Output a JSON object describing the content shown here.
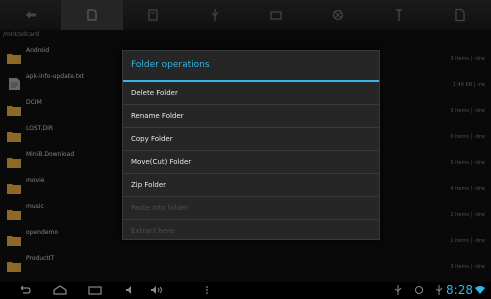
{
  "tabs": [
    {
      "id": "back",
      "icon": "back-arrow-icon",
      "active": false
    },
    {
      "id": "sdcard",
      "icon": "sdcard-icon",
      "active": true
    },
    {
      "id": "internal",
      "icon": "storage-icon",
      "active": false
    },
    {
      "id": "usb",
      "icon": "usb-icon",
      "active": false
    },
    {
      "id": "media",
      "icon": "card-icon",
      "active": false
    },
    {
      "id": "settings",
      "icon": "gear-icon",
      "active": false
    },
    {
      "id": "tools",
      "icon": "hammer-icon",
      "active": false
    },
    {
      "id": "file",
      "icon": "file-icon",
      "active": false
    }
  ],
  "path": "/mnt/sdcard",
  "files": [
    {
      "name": "Android",
      "info": "3 items | -drw",
      "type": "folder"
    },
    {
      "name": "apk-info-update.txt",
      "info": "1.46 KB | -rw",
      "type": "file"
    },
    {
      "name": "DCIM",
      "info": "3 items | -drw",
      "type": "folder"
    },
    {
      "name": "LOST.DIR",
      "info": "0 items | -drw",
      "type": "folder"
    },
    {
      "name": "MiniB.Download",
      "info": "5 items | -drw",
      "type": "folder"
    },
    {
      "name": "movie",
      "info": "4 items | -drw",
      "type": "folder"
    },
    {
      "name": "music",
      "info": "2 items | -drw",
      "type": "folder"
    },
    {
      "name": "opendemo",
      "info": "1 items | -drw",
      "type": "folder"
    },
    {
      "name": "ProductIT",
      "info": "3 items | -drw",
      "type": "folder"
    }
  ],
  "dialog": {
    "title": "Folder operations",
    "options": [
      {
        "label": "Delete Folder",
        "enabled": true
      },
      {
        "label": "Rename Folder",
        "enabled": true
      },
      {
        "label": "Copy Folder",
        "enabled": true
      },
      {
        "label": "Move(Cut) Folder",
        "enabled": true
      },
      {
        "label": "Zip Folder",
        "enabled": true
      },
      {
        "label": "Paste into folder",
        "enabled": false
      },
      {
        "label": "Extract here",
        "enabled": false
      }
    ]
  },
  "statusbar": {
    "time": "8:28"
  },
  "colors": {
    "accent": "#33b5e5",
    "folder": "#d8a13a"
  }
}
